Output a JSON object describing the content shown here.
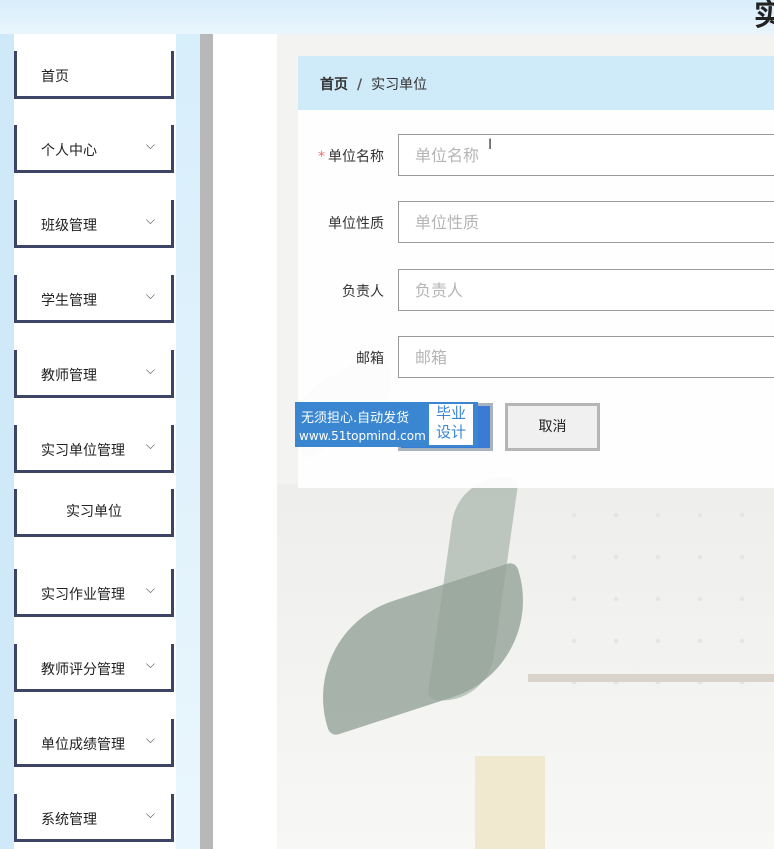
{
  "header": {
    "title_fragment": "实"
  },
  "sidebar": {
    "items": [
      {
        "label": "首页",
        "chevron": ""
      },
      {
        "label": "个人中心",
        "chevron": "⌵"
      },
      {
        "label": "班级管理",
        "chevron": "⌵"
      },
      {
        "label": "学生管理",
        "chevron": "⌵"
      },
      {
        "label": "教师管理",
        "chevron": "⌵"
      },
      {
        "label": "实习单位管理",
        "chevron": "⌵"
      },
      {
        "label": "实习作业管理",
        "chevron": "⌵"
      },
      {
        "label": "教师评分管理",
        "chevron": "⌵"
      },
      {
        "label": "单位成绩管理",
        "chevron": "⌵"
      },
      {
        "label": "系统管理",
        "chevron": "⌵"
      }
    ],
    "subitem": {
      "label": "实习单位"
    }
  },
  "breadcrumb": {
    "home": "首页",
    "separator": "/",
    "current": "实习单位"
  },
  "form": {
    "required_mark": "*",
    "fields": [
      {
        "label": "单位名称",
        "placeholder": "单位名称",
        "value": ""
      },
      {
        "label": "单位性质",
        "placeholder": "单位性质",
        "value": ""
      },
      {
        "label": "负责人",
        "placeholder": "负责人",
        "value": ""
      },
      {
        "label": "邮箱",
        "placeholder": "邮箱",
        "value": ""
      }
    ],
    "cancel_label": "取消"
  },
  "watermark": {
    "line1": "无须担心.自动发货",
    "line2": "www.51topmind.com",
    "badge_line1": "毕业",
    "badge_line2": "设计"
  },
  "colors": {
    "accent": "#3a7bd5",
    "breadcrumb_bg": "#cfeaf8",
    "nav_border": "#3d4466",
    "required": "#f56c6c"
  }
}
